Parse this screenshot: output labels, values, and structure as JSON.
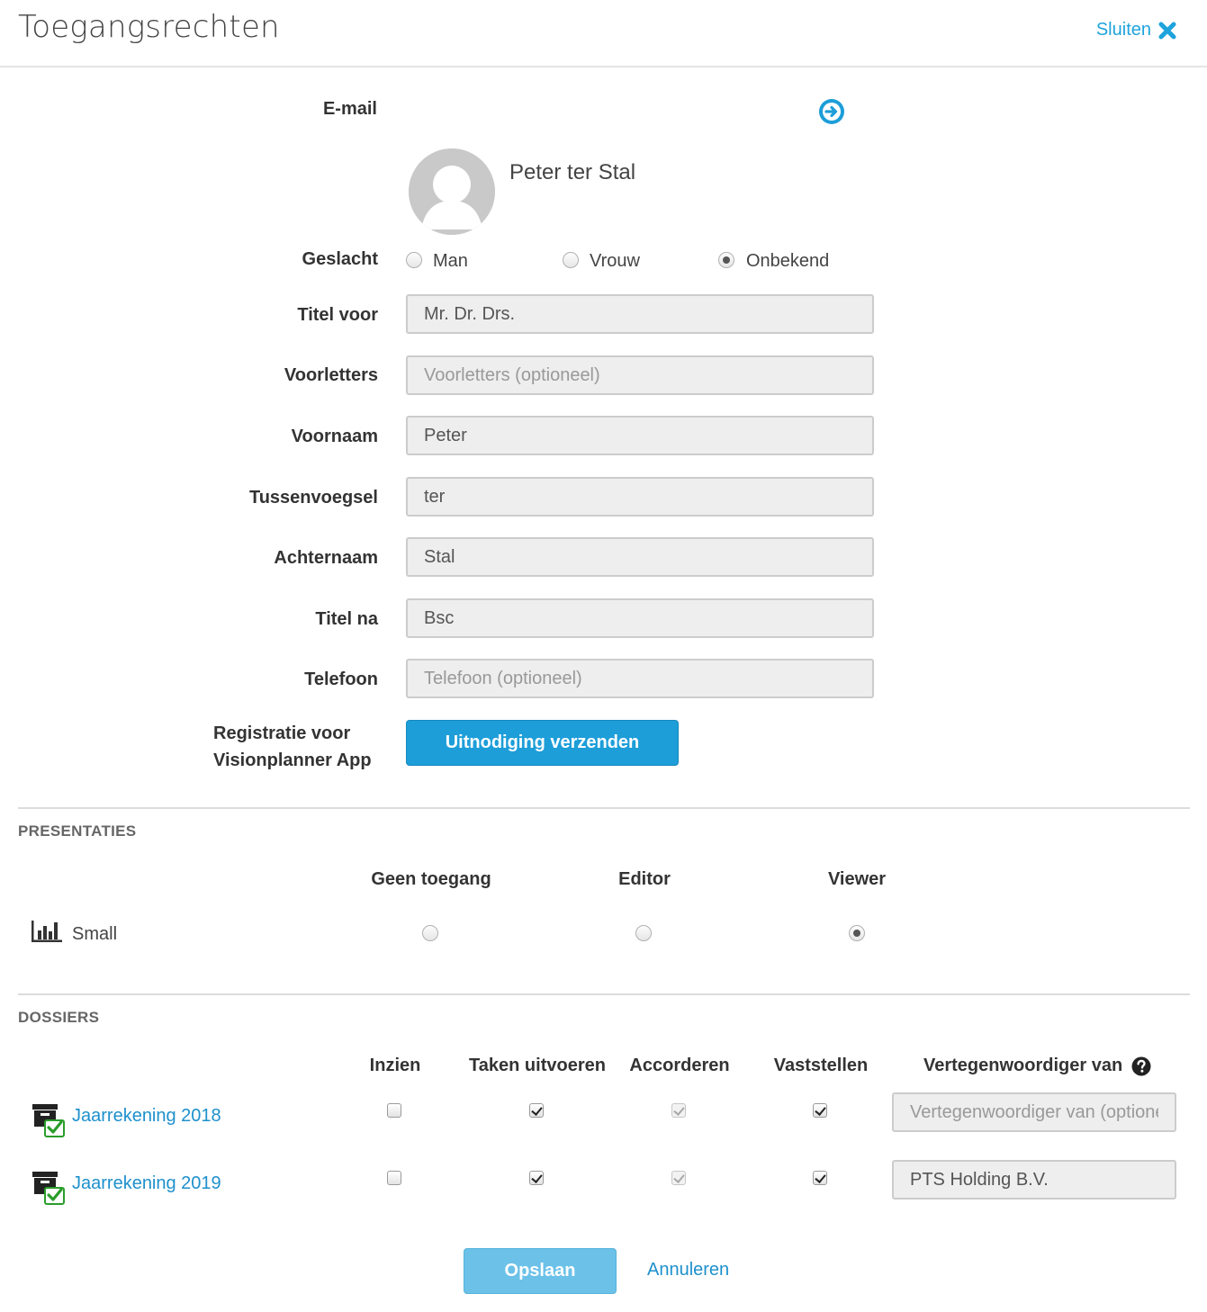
{
  "header": {
    "title": "Toegangsrechten",
    "close_label": "Sluiten"
  },
  "form": {
    "email_label": "E-mail",
    "user_name": "Peter ter Stal",
    "gender": {
      "label": "Geslacht",
      "options": [
        "Man",
        "Vrouw",
        "Onbekend"
      ],
      "selected": "Onbekend"
    },
    "fields": [
      {
        "label": "Titel voor",
        "value": "Mr. Dr. Drs.",
        "placeholder": ""
      },
      {
        "label": "Voorletters",
        "value": "",
        "placeholder": "Voorletters (optioneel)"
      },
      {
        "label": "Voornaam",
        "value": "Peter",
        "placeholder": ""
      },
      {
        "label": "Tussenvoegsel",
        "value": "ter",
        "placeholder": ""
      },
      {
        "label": "Achternaam",
        "value": "Stal",
        "placeholder": ""
      },
      {
        "label": "Titel na",
        "value": "Bsc",
        "placeholder": ""
      },
      {
        "label": "Telefoon",
        "value": "",
        "placeholder": "Telefoon (optioneel)"
      }
    ],
    "registration_label_line1": "Registratie voor",
    "registration_label_line2": "Visionplanner App",
    "invite_button": "Uitnodiging verzenden"
  },
  "presentaties": {
    "title": "PRESENTATIES",
    "columns": [
      "Geen toegang",
      "Editor",
      "Viewer"
    ],
    "rows": [
      {
        "name": "Small",
        "icon": "bar-chart-icon",
        "selected": "Viewer"
      }
    ]
  },
  "dossiers": {
    "title": "DOSSIERS",
    "columns": [
      "Inzien",
      "Taken uitvoeren",
      "Accorderen",
      "Vaststellen",
      "Vertegenwoordiger van"
    ],
    "rows": [
      {
        "name": "Jaarrekening 2018",
        "inzien": false,
        "taken": true,
        "accorderen": true,
        "vaststellen": true,
        "vertegenwoordiger_value": "",
        "vertegenwoordiger_placeholder": "Vertegenwoordiger van (optioneel)"
      },
      {
        "name": "Jaarrekening 2019",
        "inzien": false,
        "taken": true,
        "accorderen": true,
        "vaststellen": true,
        "vertegenwoordiger_value": "PTS Holding B.V.",
        "vertegenwoordiger_placeholder": "Vertegenwoordiger van (optioneel)"
      }
    ]
  },
  "footer": {
    "save_label": "Opslaan",
    "cancel_label": "Annuleren"
  },
  "colors": {
    "accent": "#1d9ed9",
    "link": "#1e90cc",
    "save_button": "#6bc1e8",
    "check_green": "#2a9d2a"
  }
}
